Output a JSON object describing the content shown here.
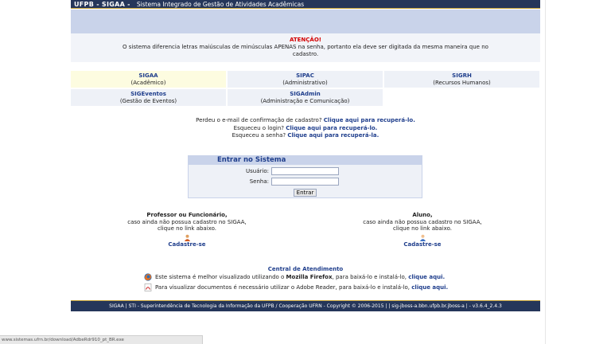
{
  "header": {
    "brand": "UFPB - SIGAA -",
    "subtitle": "Sistema Integrado de Gestão de Atividades Acadêmicas"
  },
  "notice": {
    "title": "ATENÇÃO!",
    "text": "O sistema diferencia letras maiúsculas de minúsculas APENAS na senha, portanto ela deve ser digitada da mesma maneira que no cadastro."
  },
  "systems": [
    {
      "name": "SIGAA",
      "desc": "(Acadêmico)"
    },
    {
      "name": "SIPAC",
      "desc": "(Administrativo)"
    },
    {
      "name": "SIGRH",
      "desc": "(Recursos Humanos)"
    },
    {
      "name": "SIGEventos",
      "desc": "(Gestão de Eventos)"
    },
    {
      "name": "SIGAdmin",
      "desc": "(Administração e Comunicação)"
    }
  ],
  "recover": [
    {
      "text": "Perdeu o e-mail de confirmação de cadastro?",
      "link": "Clique aqui para recuperá-lo."
    },
    {
      "text": "Esqueceu o login?",
      "link": "Clique aqui para recuperá-lo."
    },
    {
      "text": "Esqueceu a senha?",
      "link": "Clique aqui para recuperá-la."
    }
  ],
  "login": {
    "title": "Entrar no Sistema",
    "user_label": "Usuário:",
    "pass_label": "Senha:",
    "user_value": "",
    "pass_value": "",
    "submit": "Entrar"
  },
  "cadastro": {
    "left": {
      "title": "Professor ou Funcionário,",
      "line1": "caso ainda não possua cadastro no SIGAA,",
      "line2": "clique no link abaixo.",
      "link": "Cadastre-se"
    },
    "right": {
      "title": "Aluno,",
      "line1": "caso ainda não possua cadastro no SIGAA,",
      "line2": "clique no link abaixo.",
      "link": "Cadastre-se"
    }
  },
  "central": "Central de Atendimento",
  "tips": {
    "firefox": {
      "pre": "Este sistema é melhor visualizado utilizando o",
      "bold": "Mozilla Firefox",
      "mid": ", para baixá-lo e instalá-lo,",
      "link": "clique aqui."
    },
    "adobe": {
      "pre": "Para visualizar documentos é necessário utilizar o Adobe Reader, para baixá-lo e instalá-lo,",
      "link": "clique aqui."
    }
  },
  "footer": "SIGAA | STI - Superintendência de Tecnologia da Informação da UFPB / Cooperação UFRN - Copyright © 2006-2015 | | sig-jboss-a.bbn.ufpb.br.jboss-a | - v3.6.4_2.4.3",
  "statusbar": "www.sistemas.ufrn.br/download/AdbeRdr910_pt_BR.exe",
  "colors": {
    "navy": "#25365a",
    "link": "#1f3e8c",
    "warn": "#d40000",
    "accent": "#c8a43a"
  }
}
